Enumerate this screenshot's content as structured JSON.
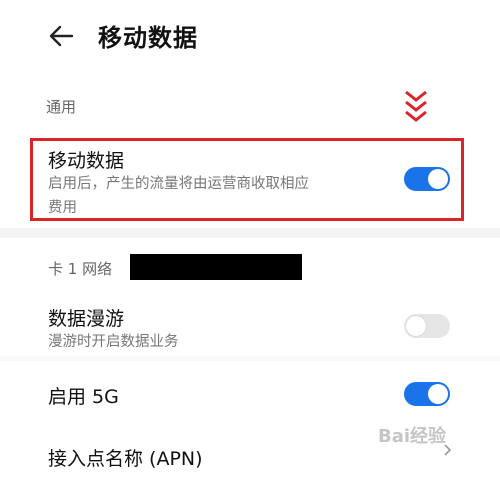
{
  "header": {
    "title": "移动数据"
  },
  "general": {
    "label": "通用"
  },
  "mobile_data": {
    "title": "移动数据",
    "subtitle_line1": "启用后，产生的流量将由运营商收取相应",
    "subtitle_line2": "费用",
    "enabled": true
  },
  "sim1": {
    "label": "卡 1 网络"
  },
  "roaming": {
    "title": "数据漫游",
    "subtitle": "漫游时开启数据业务",
    "enabled": false
  },
  "fiveg": {
    "title": "启用 5G",
    "enabled": true
  },
  "apn": {
    "title": "接入点名称 (APN)"
  },
  "watermark": {
    "text": "Bai经验"
  },
  "colors": {
    "accent": "#1a73e8",
    "highlight": "#d9242a",
    "toggle_off": "#e6e6e6"
  }
}
